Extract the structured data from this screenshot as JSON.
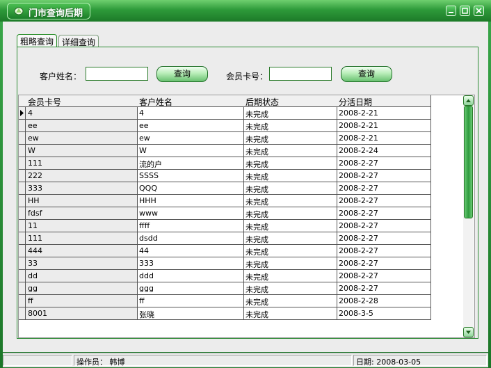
{
  "window": {
    "title": "门市查询后期",
    "controls": [
      "minimize-icon",
      "maximize-icon",
      "close-icon"
    ],
    "accent_color": "#2e9a3a"
  },
  "tabs": [
    {
      "label": "粗略查询",
      "active": true
    },
    {
      "label": "详细查询",
      "active": false
    }
  ],
  "search": {
    "customer_name_label": "客户姓名：",
    "customer_name_value": "",
    "query_button_1": "查询",
    "member_card_label": "会员卡号：",
    "member_card_value": "",
    "query_button_2": "查询"
  },
  "grid": {
    "columns": [
      "会员卡号",
      "客户姓名",
      "后期状态",
      "分活日期"
    ],
    "rows": [
      [
        "4",
        "4",
        "未完成",
        "2008-2-21"
      ],
      [
        "ee",
        "ee",
        "未完成",
        "2008-2-21"
      ],
      [
        "ew",
        "ew",
        "未完成",
        "2008-2-21"
      ],
      [
        "W",
        "W",
        "未完成",
        "2008-2-24"
      ],
      [
        "111",
        "流的户",
        "未完成",
        "2008-2-27"
      ],
      [
        "222",
        "SSSS",
        "未完成",
        "2008-2-27"
      ],
      [
        "333",
        "QQQ",
        "未完成",
        "2008-2-27"
      ],
      [
        "HH",
        "HHH",
        "未完成",
        "2008-2-27"
      ],
      [
        "fdsf",
        "www",
        "未完成",
        "2008-2-27"
      ],
      [
        "11",
        "ffff",
        "未完成",
        "2008-2-27"
      ],
      [
        "111",
        "dsdd",
        "未完成",
        "2008-2-27"
      ],
      [
        "444",
        "44",
        "未完成",
        "2008-2-27"
      ],
      [
        "33",
        "333",
        "未完成",
        "2008-2-27"
      ],
      [
        "dd",
        "ddd",
        "未完成",
        "2008-2-27"
      ],
      [
        "gg",
        "ggg",
        "未完成",
        "2008-2-27"
      ],
      [
        "ff",
        "ff",
        "未完成",
        "2008-2-28"
      ],
      [
        "8001",
        "张晓",
        "未完成",
        "2008-3-5"
      ]
    ],
    "selected_row": 0
  },
  "status": {
    "operator_label": "操作员：",
    "operator_name": "韩博",
    "date_label": "日期:",
    "date_value": "2008-03-05"
  }
}
